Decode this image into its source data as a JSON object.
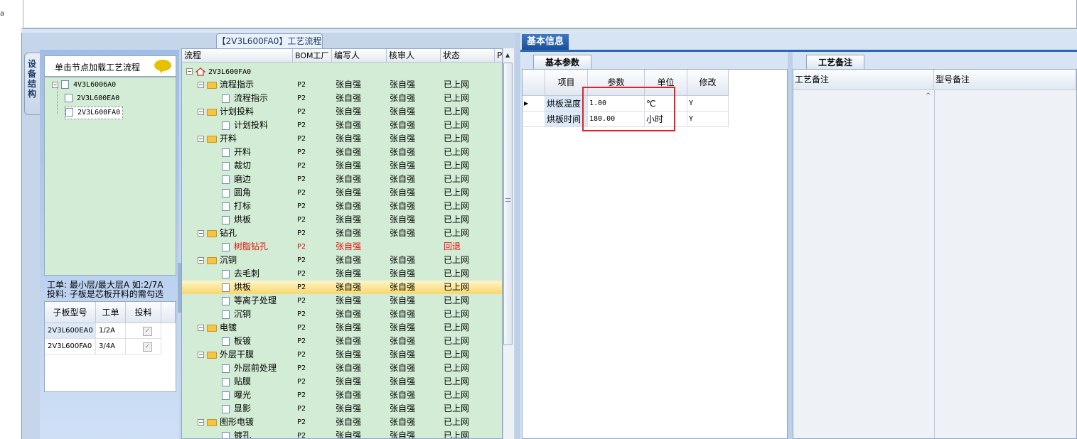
{
  "edge_char": "a",
  "side_tab": "设备结构",
  "left_panel": {
    "hint": "单击节点加载工艺流程",
    "tree": [
      "4V3L6006A0",
      "2V3L600EA0",
      "2V3L600FA0"
    ],
    "note_line1": "工单: 最小层/最大层A 如:2/7A",
    "note_line2": "投料: 子板是芯板开料的需勾选",
    "sub_headers": [
      "子板型号",
      "工单",
      "投料"
    ],
    "sub_rows": [
      {
        "model": "2V3L600EA0",
        "order": "1/2A",
        "feed": "✓"
      },
      {
        "model": "2V3L600FA0",
        "order": "3/4A",
        "feed": "✓"
      }
    ]
  },
  "process": {
    "title": "【2V3L600FA0】工艺流程",
    "headers": [
      "流程",
      "BOM工厂",
      "编写人",
      "核审人",
      "状态",
      "P"
    ],
    "root": "2V3L600FA0",
    "rows": [
      {
        "name": "流程指示",
        "type": "folder",
        "f": "P2",
        "w": "张自强",
        "r": "张自强",
        "s": "已上网"
      },
      {
        "name": "流程指示",
        "type": "doc",
        "f": "P2",
        "w": "张自强",
        "r": "张自强",
        "s": "已上网"
      },
      {
        "name": "计划投料",
        "type": "folder",
        "f": "P2",
        "w": "张自强",
        "r": "张自强",
        "s": "已上网"
      },
      {
        "name": "计划投料",
        "type": "doc",
        "f": "P2",
        "w": "张自强",
        "r": "张自强",
        "s": "已上网"
      },
      {
        "name": "开料",
        "type": "folder",
        "f": "P2",
        "w": "张自强",
        "r": "张自强",
        "s": "已上网"
      },
      {
        "name": "开料",
        "type": "doc",
        "f": "P2",
        "w": "张自强",
        "r": "张自强",
        "s": "已上网"
      },
      {
        "name": "裁切",
        "type": "doc",
        "f": "P2",
        "w": "张自强",
        "r": "张自强",
        "s": "已上网"
      },
      {
        "name": "磨边",
        "type": "doc",
        "f": "P2",
        "w": "张自强",
        "r": "张自强",
        "s": "已上网"
      },
      {
        "name": "圆角",
        "type": "doc",
        "f": "P2",
        "w": "张自强",
        "r": "张自强",
        "s": "已上网"
      },
      {
        "name": "打标",
        "type": "doc",
        "f": "P2",
        "w": "张自强",
        "r": "张自强",
        "s": "已上网"
      },
      {
        "name": "烘板",
        "type": "doc",
        "f": "P2",
        "w": "张自强",
        "r": "张自强",
        "s": "已上网"
      },
      {
        "name": "钻孔",
        "type": "folder",
        "f": "P2",
        "w": "张自强",
        "r": "张自强",
        "s": "已上网"
      },
      {
        "name": "树脂钻孔",
        "type": "doc",
        "f": "P2",
        "w": "张自强",
        "r": "",
        "s": "回退",
        "red": true
      },
      {
        "name": "沉铜",
        "type": "folder",
        "f": "P2",
        "w": "张自强",
        "r": "张自强",
        "s": "已上网"
      },
      {
        "name": "去毛刺",
        "type": "doc",
        "f": "P2",
        "w": "张自强",
        "r": "张自强",
        "s": "已上网"
      },
      {
        "name": "烘板",
        "type": "doc",
        "f": "P2",
        "w": "张自强",
        "r": "张自强",
        "s": "已上网",
        "sel": true
      },
      {
        "name": "等离子处理",
        "type": "doc",
        "f": "P2",
        "w": "张自强",
        "r": "张自强",
        "s": "已上网"
      },
      {
        "name": "沉铜",
        "type": "doc",
        "f": "P2",
        "w": "张自强",
        "r": "张自强",
        "s": "已上网"
      },
      {
        "name": "电镀",
        "type": "folder",
        "f": "P2",
        "w": "张自强",
        "r": "张自强",
        "s": "已上网"
      },
      {
        "name": "板镀",
        "type": "doc",
        "f": "P2",
        "w": "张自强",
        "r": "张自强",
        "s": "已上网"
      },
      {
        "name": "外层干膜",
        "type": "folder",
        "f": "P2",
        "w": "张自强",
        "r": "张自强",
        "s": "已上网"
      },
      {
        "name": "外层前处理",
        "type": "doc",
        "f": "P2",
        "w": "张自强",
        "r": "张自强",
        "s": "已上网"
      },
      {
        "name": "贴膜",
        "type": "doc",
        "f": "P2",
        "w": "张自强",
        "r": "张自强",
        "s": "已上网"
      },
      {
        "name": "曝光",
        "type": "doc",
        "f": "P2",
        "w": "张自强",
        "r": "张自强",
        "s": "已上网"
      },
      {
        "name": "显影",
        "type": "doc",
        "f": "P2",
        "w": "张自强",
        "r": "张自强",
        "s": "已上网"
      },
      {
        "name": "图形电镀",
        "type": "folder",
        "f": "P2",
        "w": "张自强",
        "r": "张自强",
        "s": "已上网"
      },
      {
        "name": "镀孔",
        "type": "doc",
        "f": "P2",
        "w": "张自强",
        "r": "张自强",
        "s": "已上网"
      }
    ]
  },
  "right": {
    "main_tab": "基本信息",
    "params_tab": "基本参数",
    "notes_tab": "工艺备注",
    "param_headers": [
      "项目",
      "参数",
      "单位",
      "修改"
    ],
    "params": [
      {
        "item": "烘板温度",
        "value": "1.00",
        "unit": "℃",
        "modify": "Y"
      },
      {
        "item": "烘板时间",
        "value": "180.00",
        "unit": "小时",
        "modify": "Y"
      }
    ],
    "note_headers": [
      "工艺备注",
      "型号备注"
    ]
  },
  "colors": {
    "tree_bg": "#d2ecd5",
    "selected_row": "#f7d76e",
    "highlight_box": "#e02424",
    "tab_blue": "#1a4f99"
  }
}
